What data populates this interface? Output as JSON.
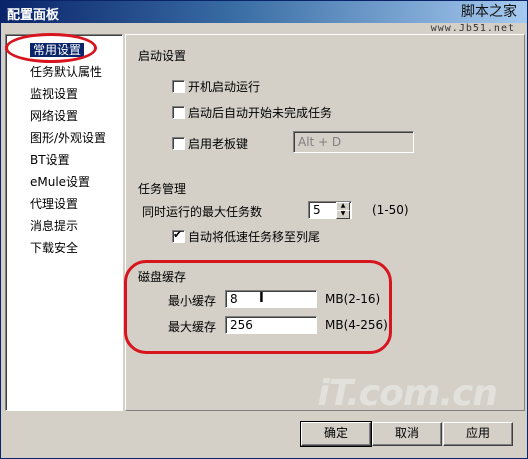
{
  "window": {
    "title": "配置面板"
  },
  "watermark": {
    "line1": "脚本之家",
    "line2": "www.Jb51.net",
    "logo": "iT.com.cn"
  },
  "nav": {
    "items": [
      "常用设置",
      "任务默认属性",
      "监视设置",
      "网络设置",
      "图形/外观设置",
      "BT设置",
      "eMule设置",
      "代理设置",
      "消息提示",
      "下载安全"
    ],
    "selected_index": 0
  },
  "startup": {
    "heading": "启动设置",
    "auto_start": {
      "label": "开机启动运行",
      "checked": false
    },
    "resume_tasks": {
      "label": "启动后自动开始未完成任务",
      "checked": false
    },
    "boss_key": {
      "label": "启用老板键",
      "checked": false,
      "value": "Alt + D"
    }
  },
  "tasks": {
    "heading": "任务管理",
    "max_tasks_label": "同时运行的最大任务数",
    "max_tasks_value": "5",
    "max_tasks_range": "(1-50)",
    "move_slow": {
      "label": "自动将低速任务移至列尾",
      "checked": true,
      "mark": "✔"
    }
  },
  "cache": {
    "heading": "磁盘缓存",
    "min_label": "最小缓存",
    "min_value": "8",
    "min_range": "MB(2-16)",
    "max_label": "最大缓存",
    "max_value": "256",
    "max_range": "MB(4-256)"
  },
  "buttons": {
    "ok": "确定",
    "cancel": "取消",
    "apply": "应用"
  },
  "colors": {
    "annotation_red": "#d8141e",
    "selection": "#0a246a"
  }
}
